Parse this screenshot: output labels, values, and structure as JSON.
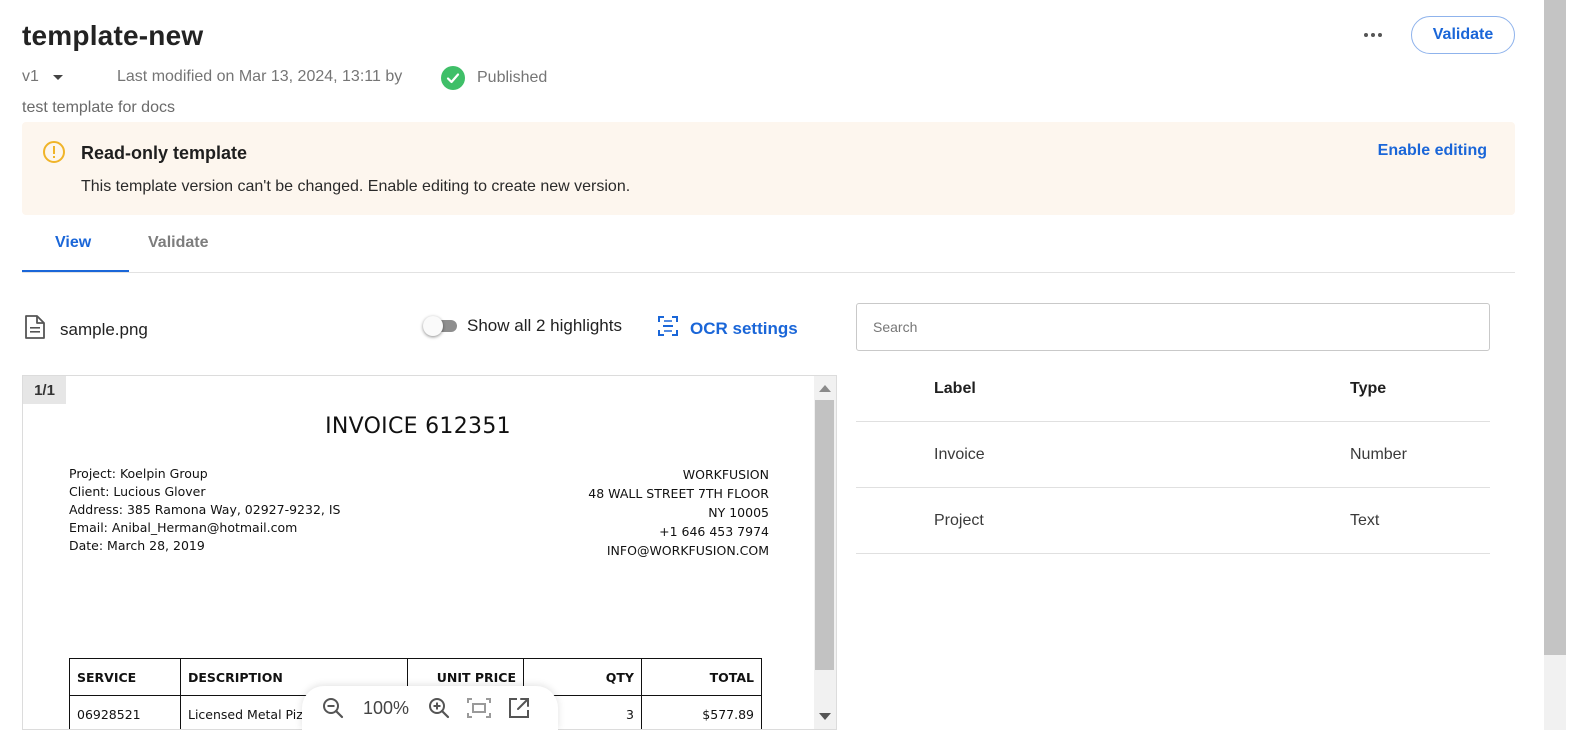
{
  "header": {
    "title": "template-new",
    "version": "v1",
    "last_modified": "Last modified on Mar 13, 2024, 13:11 by",
    "status": "Published",
    "description": "test template for docs",
    "validate_label": "Validate"
  },
  "banner": {
    "title": "Read-only template",
    "text": "This template version can't be changed. Enable editing to create new version.",
    "action": "Enable editing"
  },
  "tabs": [
    {
      "label": "View"
    },
    {
      "label": "Validate"
    }
  ],
  "toolbar": {
    "file_name": "sample.png",
    "highlights_label": "Show all 2 highlights",
    "ocr_label": "OCR settings"
  },
  "search": {
    "placeholder": "Search"
  },
  "fields": {
    "headers": {
      "label": "Label",
      "type": "Type"
    },
    "rows": [
      {
        "label": "Invoice",
        "type": "Number"
      },
      {
        "label": "Project",
        "type": "Text"
      }
    ]
  },
  "viewer": {
    "page": "1/1",
    "zoom": "100%"
  },
  "document": {
    "title": "INVOICE 612351",
    "left_lines": [
      "Project: Koelpin Group",
      "Client: Lucious Glover",
      "Address: 385 Ramona Way, 02927-9232, IS",
      "Email: Anibal_Herman@hotmail.com",
      "Date: March 28, 2019"
    ],
    "right_lines": [
      "WORKFUSION",
      "48 WALL STREET 7TH FLOOR",
      "NY 10005",
      "+1 646 453 7974",
      "INFO@WORKFUSION.COM"
    ],
    "table_headers": [
      "SERVICE",
      "DESCRIPTION",
      "UNIT PRICE",
      "QTY",
      "TOTAL"
    ],
    "table_row": [
      "06928521",
      "Licensed Metal Pizza",
      "",
      "3",
      "$577.89"
    ]
  },
  "colors": {
    "accent": "#1a66d8",
    "success": "#3fbf68",
    "warning": "#f0b429",
    "banner_bg": "#fdf6ee"
  }
}
